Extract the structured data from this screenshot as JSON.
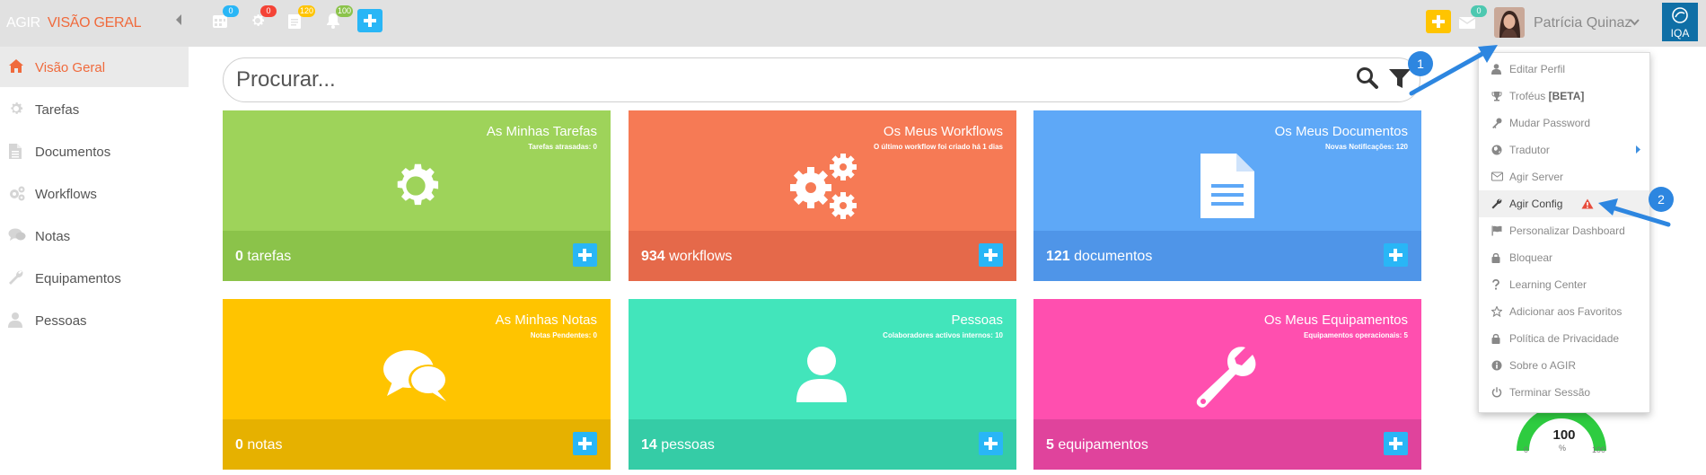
{
  "header": {
    "brand": "AGIR",
    "section": "VISÃO GERAL",
    "badges": {
      "calendar": "0",
      "settings": "0",
      "documents": "120",
      "notifications": "100",
      "messages": "0"
    },
    "user_name": "Patrícia Quinaz",
    "logo_text": "IQA"
  },
  "sidebar": {
    "items": [
      {
        "label": "Visão Geral",
        "icon": "home-icon"
      },
      {
        "label": "Tarefas",
        "icon": "gear-icon"
      },
      {
        "label": "Documentos",
        "icon": "document-icon"
      },
      {
        "label": "Workflows",
        "icon": "gears-icon"
      },
      {
        "label": "Notas",
        "icon": "comments-icon"
      },
      {
        "label": "Equipamentos",
        "icon": "wrench-icon"
      },
      {
        "label": "Pessoas",
        "icon": "user-icon"
      }
    ]
  },
  "search": {
    "placeholder": "Procurar..."
  },
  "tiles": [
    {
      "title": "As Minhas Tarefas",
      "subtitle": "Tarefas atrasadas: 0",
      "count": "0",
      "unit": "tarefas",
      "color": "#9ed35a",
      "footer_color": "#8bc34a",
      "icon": "gear-icon"
    },
    {
      "title": "Os Meus Workflows",
      "subtitle": "O último workflow foi criado há 1 dias",
      "count": "934",
      "unit": "workflows",
      "color": "#f67a55",
      "footer_color": "#e5694a",
      "icon": "gears-icon"
    },
    {
      "title": "Os Meus Documentos",
      "subtitle": "Novas Notificações: 120",
      "count": "121",
      "unit": "documentos",
      "color": "#5ea8f7",
      "footer_color": "#4f95e8",
      "icon": "document-icon"
    },
    {
      "title": "As Minhas Notas",
      "subtitle": "Notas Pendentes: 0",
      "count": "0",
      "unit": "notas",
      "color": "#ffc400",
      "footer_color": "#e6b100",
      "icon": "comments-icon"
    },
    {
      "title": "Pessoas",
      "subtitle": "Colaboradores activos internos: 10",
      "count": "14",
      "unit": "pessoas",
      "color": "#42e5bb",
      "footer_color": "#35cca6",
      "icon": "user-icon"
    },
    {
      "title": "Os Meus Equipamentos",
      "subtitle": "Equipamentos operacionais: 5",
      "count": "5",
      "unit": "equipamentos",
      "color": "#ff4faf",
      "footer_color": "#e0439c",
      "icon": "wrench-icon"
    }
  ],
  "user_menu": {
    "items": [
      {
        "label": "Editar Perfil",
        "icon": "user-icon"
      },
      {
        "label": "Troféus",
        "label_extra": "[BETA]",
        "icon": "trophy-icon"
      },
      {
        "label": "Mudar Password",
        "icon": "key-icon"
      },
      {
        "label": "Tradutor",
        "icon": "globe-icon"
      },
      {
        "label": "Agir Server",
        "icon": "server-icon"
      },
      {
        "label": "Agir Config",
        "icon": "wrench-icon",
        "warning_icon": "warning-icon"
      },
      {
        "label": "Personalizar Dashboard",
        "icon": "flag-icon"
      },
      {
        "label": "Bloquear",
        "icon": "lock-icon"
      },
      {
        "label": "Learning Center",
        "icon": "question-icon"
      },
      {
        "label": "Adicionar aos Favoritos",
        "icon": "star-icon"
      },
      {
        "label": "Política de Privacidade",
        "icon": "lock-icon"
      },
      {
        "label": "Sobre o AGIR",
        "icon": "info-icon"
      },
      {
        "label": "Terminar Sessão",
        "icon": "power-icon"
      }
    ]
  },
  "annotations": {
    "step1": "1",
    "step2": "2"
  },
  "gauge": {
    "value": "100",
    "unit": "%",
    "min": "0",
    "max": "100"
  },
  "colors": {
    "accent": "#f06a3c",
    "arrow": "#2d86e0",
    "plus_yellow": "#ffc400",
    "plus_blue": "#29b6f6"
  }
}
